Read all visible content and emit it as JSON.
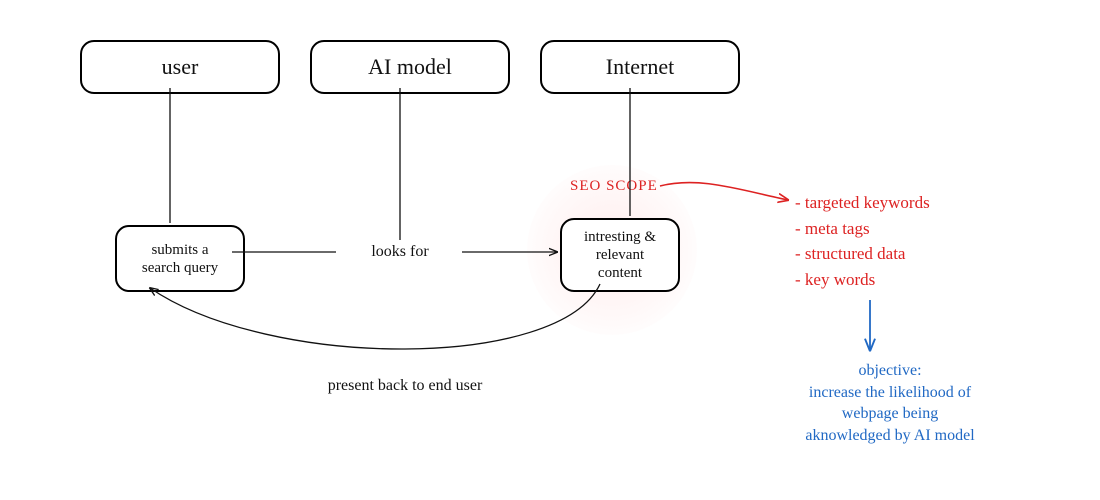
{
  "headers": {
    "user": "user",
    "ai_model": "AI model",
    "internet": "Internet"
  },
  "nodes": {
    "search_query": "submits a\nsearch query",
    "content": "intresting &\nrelevant\ncontent"
  },
  "edges": {
    "looks_for": "looks for",
    "present_back": "present back to end user"
  },
  "seo": {
    "label": "SEO SCOPE",
    "bullets": [
      "targeted keywords",
      "meta tags",
      "structured data",
      "key words"
    ]
  },
  "objective": {
    "title": "objective:",
    "body": "increase the likelihood of\nwebpage being\naknowledged by AI model"
  },
  "colors": {
    "red": "#d22",
    "blue": "#2169c4",
    "black": "#111"
  }
}
